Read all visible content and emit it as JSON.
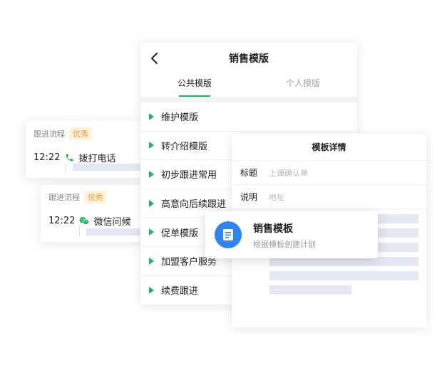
{
  "followups": [
    {
      "label": "跟进流程",
      "badge": "优秀",
      "time": "12:22",
      "action": "拨打电话",
      "icon": "phone-icon"
    },
    {
      "label": "跟进流程",
      "badge": "优秀",
      "time": "12:22",
      "action": "微信问候",
      "icon": "wechat-icon"
    }
  ],
  "template_panel": {
    "title": "销售模版",
    "tabs": [
      {
        "label": "公共模版",
        "active": true
      },
      {
        "label": "个人模版",
        "active": false
      }
    ],
    "items": [
      "维护模版",
      "转介绍模版",
      "初步跟进常用",
      "高意向后续跟进",
      "促单模版",
      "加盟客户服务",
      "续费跟进"
    ]
  },
  "detail_panel": {
    "header": "模板详情",
    "fields": [
      {
        "label": "标题",
        "value": "上课确认单"
      },
      {
        "label": "说明",
        "value": "地址"
      }
    ]
  },
  "toast": {
    "title": "销售模板",
    "subtitle": "根据模板创建计划",
    "icon": "document-icon"
  },
  "colors": {
    "accent_green": "#19b955",
    "badge_orange": "#f59a23",
    "icon_blue": "#2e84f6",
    "placeholder_bar": "#e3e8f3"
  }
}
